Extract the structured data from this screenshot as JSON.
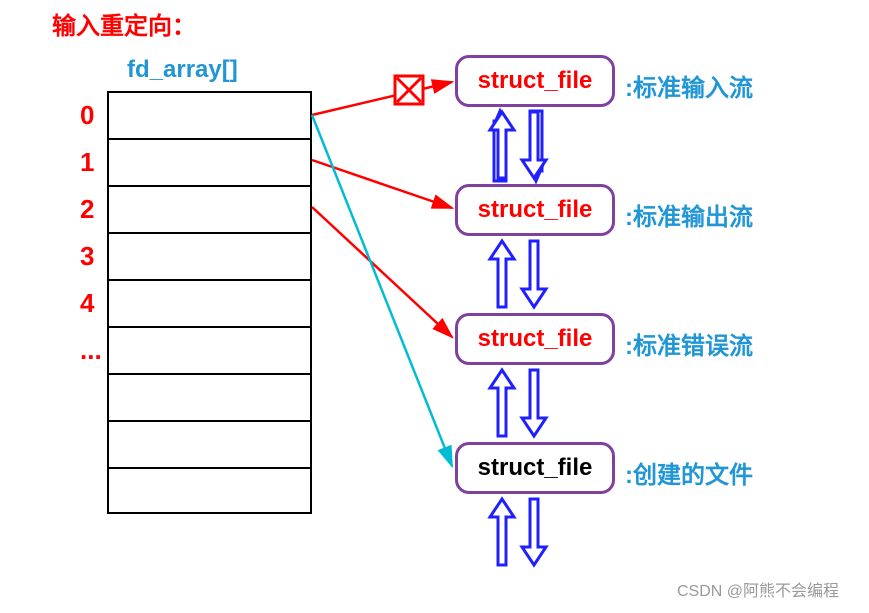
{
  "title": "输入重定向：",
  "array_label": "fd_array[]",
  "indices": [
    "0",
    "1",
    "2",
    "3",
    "4",
    "..."
  ],
  "structs": [
    {
      "label": "struct_file",
      "desc": ":标准输入流",
      "color": "red"
    },
    {
      "label": "struct_file",
      "desc": ":标准输出流",
      "color": "red"
    },
    {
      "label": "struct_file",
      "desc": ":标准错误流",
      "color": "red"
    },
    {
      "label": "struct_file",
      "desc": ":创建的文件",
      "color": "black"
    }
  ],
  "watermark": "CSDN @阿熊不会编程",
  "chart_data": {
    "type": "diagram",
    "description": "File descriptor array input redirection diagram. fd_array indices 0-4 with pointers to struct_file objects. Index 0's original pointer to stdin struct_file is crossed out (X mark), and index 0 now points to the newly created file struct_file (cyan arrow), showing input redirection. Index 1 points to stdout struct_file, index 2 points to stderr struct_file. Blue double arrows between consecutive struct_file boxes indicate linked list connections.",
    "fd_array": [
      {
        "index": 0,
        "original_target": "标准输入流",
        "redirected_target": "创建的文件",
        "crossed_out": true
      },
      {
        "index": 1,
        "target": "标准输出流"
      },
      {
        "index": 2,
        "target": "标准错误流"
      },
      {
        "index": 3,
        "target": null
      },
      {
        "index": 4,
        "target": null
      }
    ],
    "struct_files": [
      "标准输入流 (stdin)",
      "标准输出流 (stdout)",
      "标准错误流 (stderr)",
      "创建的文件 (created file)"
    ],
    "linked_list": true
  }
}
